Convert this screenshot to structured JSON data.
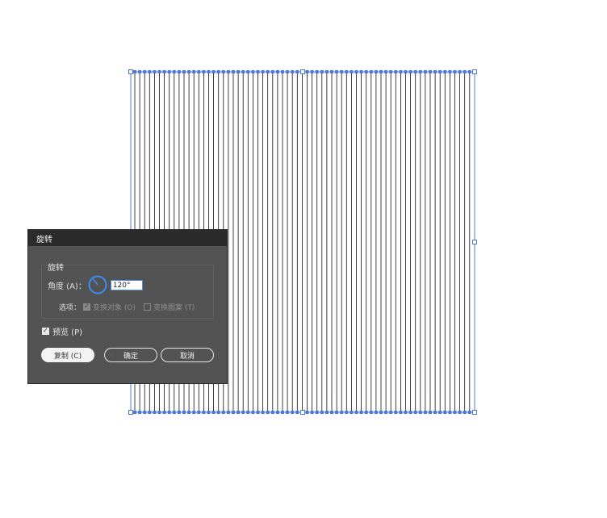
{
  "dialog": {
    "title": "旋转",
    "group_title": "旋转",
    "angle_label": "角度 (A)：",
    "angle_value": "120°",
    "options_label": "选项：",
    "option_transform_objects": "变换对象 (O)",
    "option_transform_patterns": "变换图案 (T)",
    "preview_label": "预览 (P)",
    "copy_button": "复制 (C)",
    "ok_button": "确定",
    "cancel_button": "取消"
  },
  "colors": {
    "selection": "#4a78e0",
    "dialog_bg": "#535353",
    "titlebar_bg": "#2b2b2b",
    "line_color": "#111111"
  },
  "icons": {
    "angle_dial": "angle-dial-icon",
    "checkbox": "checkbox-icon"
  }
}
